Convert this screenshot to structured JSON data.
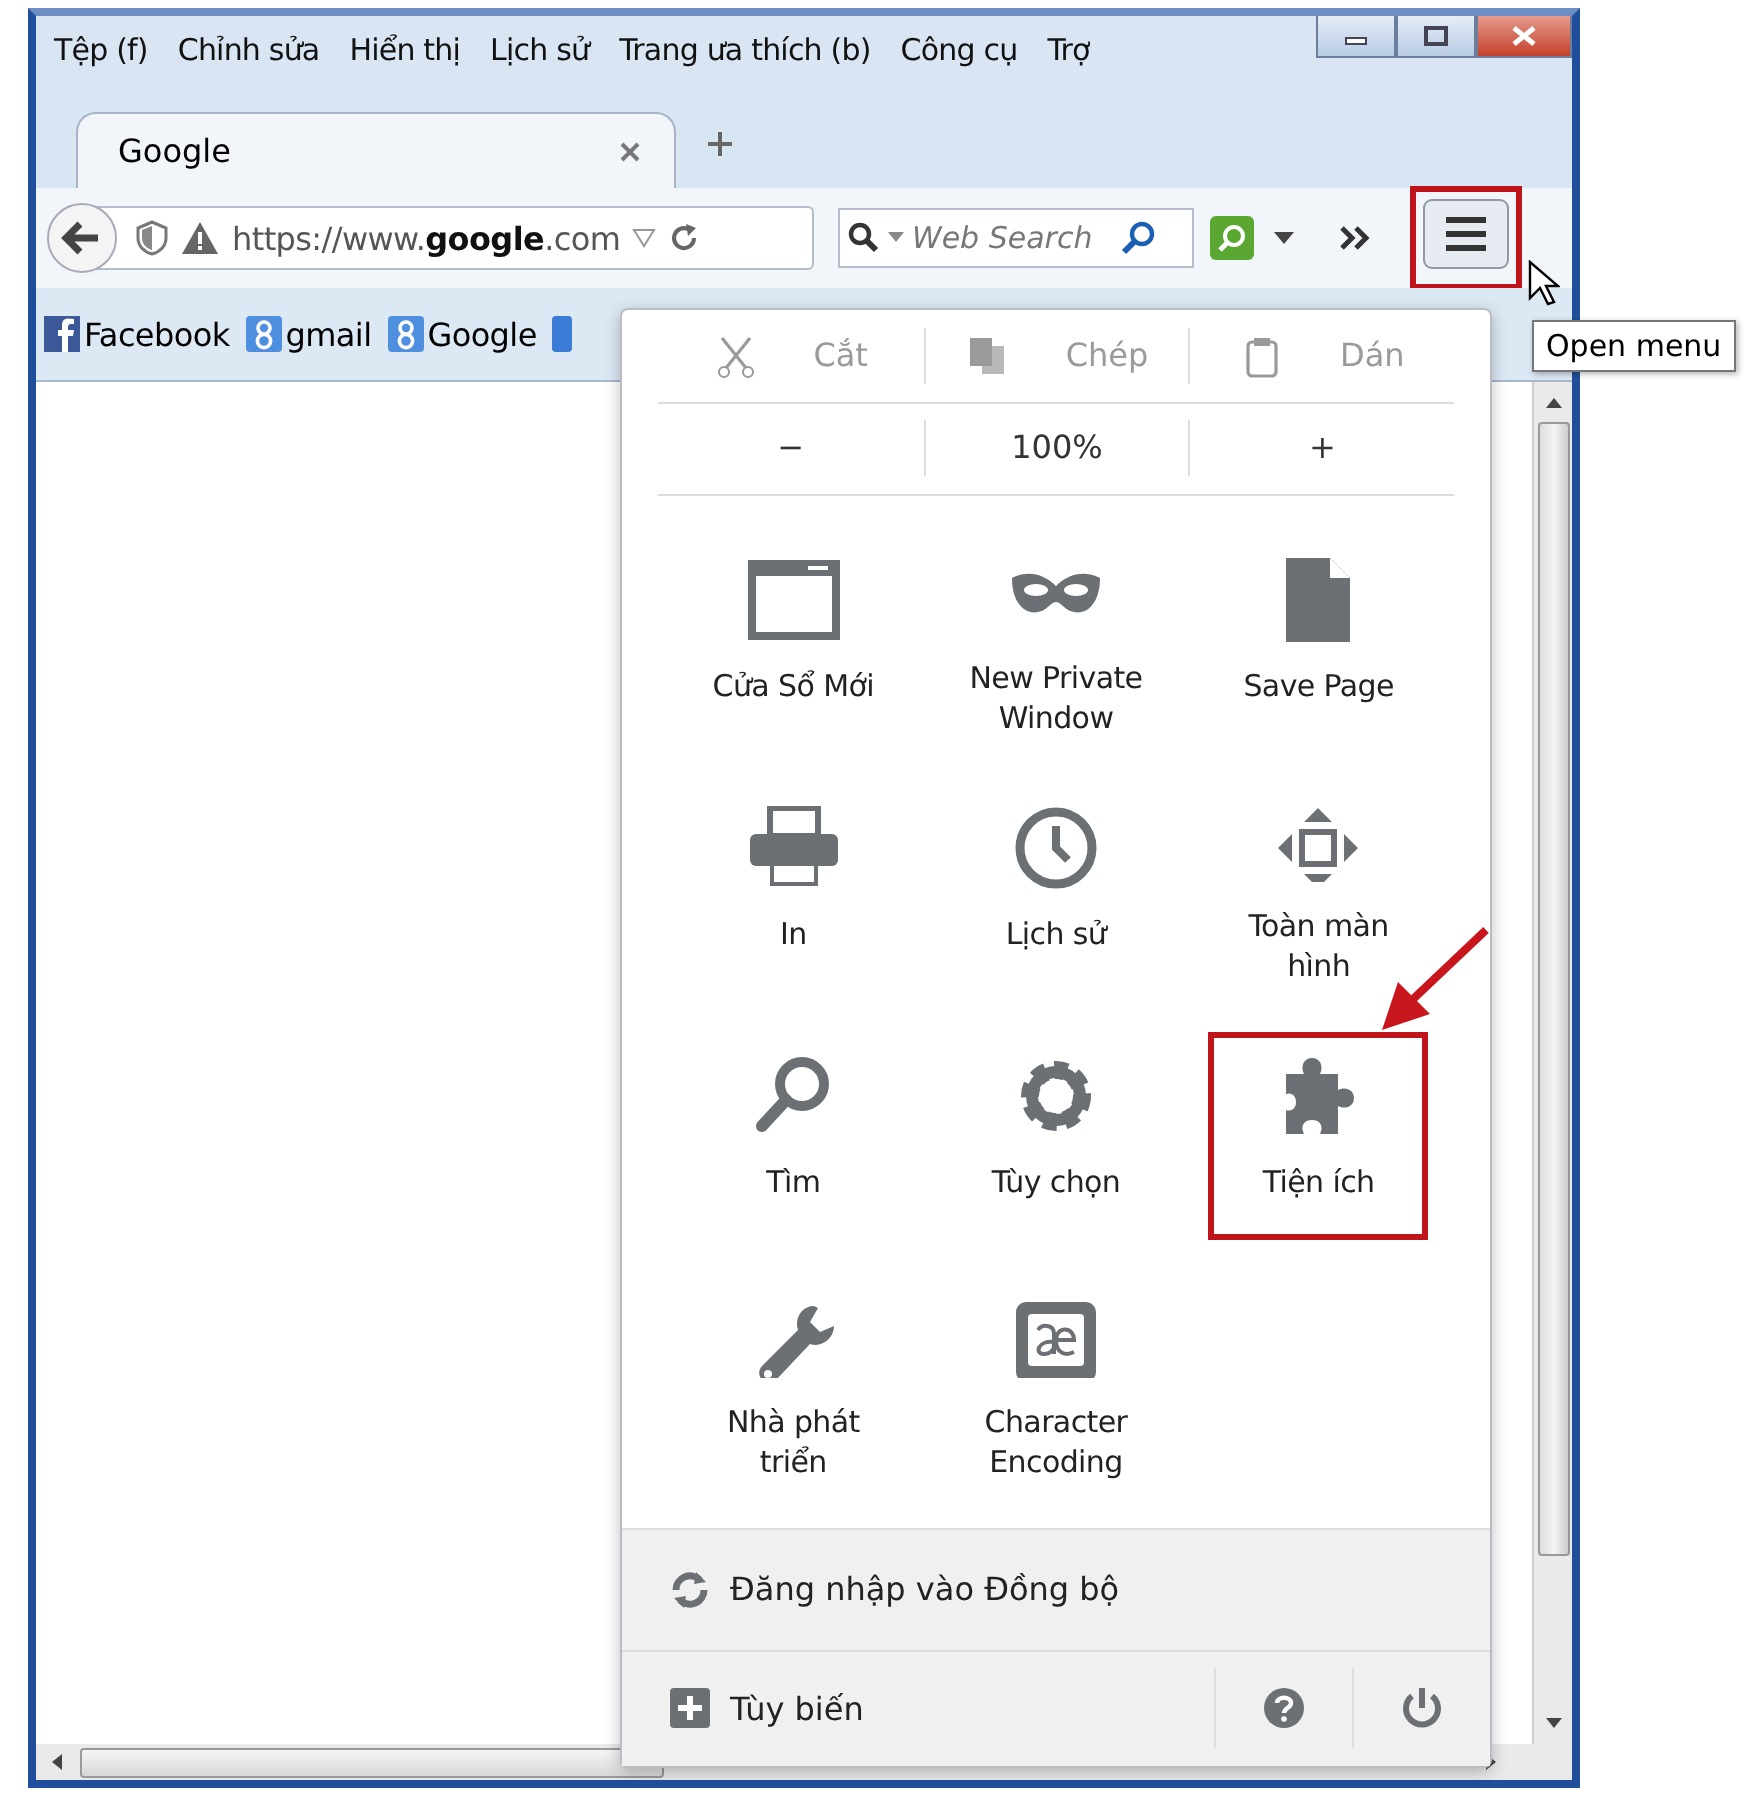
{
  "menu_bar": [
    {
      "label": "Tệp (f)"
    },
    {
      "label": "Chỉnh sửa"
    },
    {
      "label": "Hiển thị"
    },
    {
      "label": "Lịch sử"
    },
    {
      "label": "Trang ưa thích (b)"
    },
    {
      "label": "Công cụ"
    },
    {
      "label": "Trợ"
    }
  ],
  "tabs": [
    {
      "label": "Google",
      "selected": true
    }
  ],
  "nav_bar": {
    "url": "https://www.**google**.com",
    "search_placeholder": "Web Search",
    "menu_button_highlighted": true
  },
  "tooltip": "Open menu",
  "bookmarks": [
    {
      "label": "Facebook",
      "kind": "facebook"
    },
    {
      "label": "gmail",
      "kind": "google"
    },
    {
      "label": "Google",
      "kind": "google"
    }
  ],
  "menu": {
    "edit_row": [
      {
        "label": "Cắt",
        "kind": "cut",
        "disabled": true
      },
      {
        "label": "Chép",
        "kind": "copy",
        "disabled": true
      },
      {
        "label": "Dán",
        "kind": "paste",
        "disabled": true
      }
    ],
    "zoom": {
      "out": "−",
      "level": "100%",
      "in": "+"
    },
    "items": [
      {
        "label": "Cửa Sổ Mới",
        "kind": "window",
        "highlighted": false
      },
      {
        "label": "New Private Window",
        "kind": "mask",
        "highlighted": false
      },
      {
        "label": "Save Page",
        "kind": "page",
        "highlighted": false
      },
      {
        "label": "In",
        "kind": "printer",
        "highlighted": false
      },
      {
        "label": "Lịch sử",
        "kind": "clock",
        "highlighted": false
      },
      {
        "label": "Toàn màn hình",
        "kind": "fullscreen",
        "highlighted": false
      },
      {
        "label": "Tìm",
        "kind": "search",
        "highlighted": false
      },
      {
        "label": "Tùy chọn",
        "kind": "gear",
        "highlighted": false
      },
      {
        "label": "Tiện ích",
        "kind": "puzzle",
        "highlighted": true
      },
      {
        "label": "Nhà phát triển",
        "kind": "wrench",
        "highlighted": false
      },
      {
        "label": "Character Encoding",
        "kind": "encoding",
        "highlighted": false
      }
    ],
    "sync": "Đăng nhập vào Đồng bộ",
    "customize": "Tùy biến"
  }
}
